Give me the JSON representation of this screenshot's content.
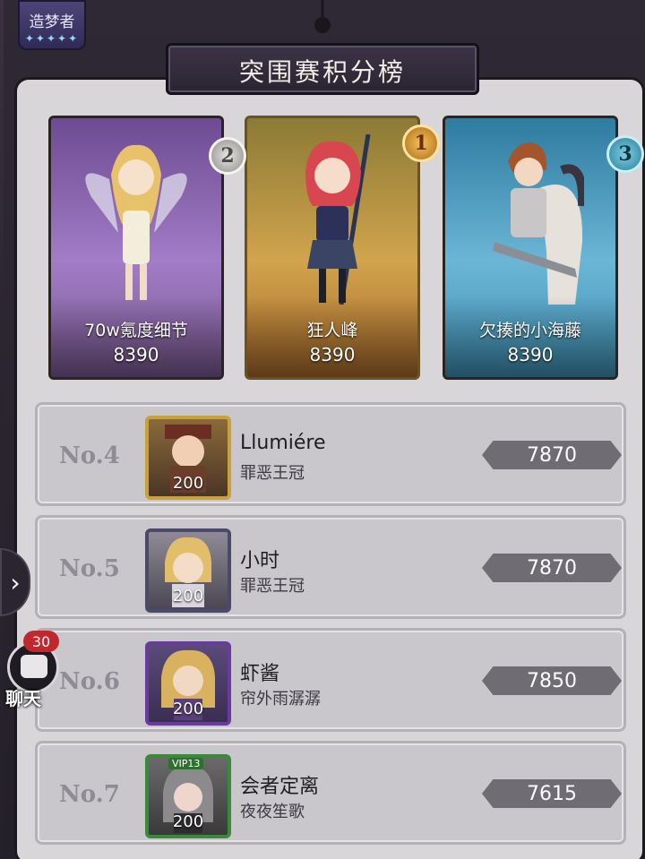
{
  "header": {
    "badge_label": "造梦者",
    "badge_stars": "✦✦✦✦✦",
    "title": "突围赛积分榜"
  },
  "podium": [
    {
      "place": "2",
      "name": "70w氪度细节",
      "score": "8390",
      "color": "#a27cc6"
    },
    {
      "place": "1",
      "name": "狂人峰",
      "score": "8390",
      "color": "#d1a44d"
    },
    {
      "place": "3",
      "name": "欠揍的小海藤",
      "score": "8390",
      "color": "#6bb6d6"
    }
  ],
  "rows": [
    {
      "rank": "No.4",
      "name": "Llumiére",
      "title": "罪恶王冠",
      "level": "200",
      "score": "7870"
    },
    {
      "rank": "No.5",
      "name": "小时",
      "title": "罪恶王冠",
      "level": "200",
      "score": "7870"
    },
    {
      "rank": "No.6",
      "name": "虾酱",
      "title": "帘外雨潺潺",
      "level": "200",
      "score": "7850"
    },
    {
      "rank": "No.7",
      "name": "会者定离",
      "title": "夜夜笙歌",
      "level": "200",
      "score": "7615",
      "vip": "VIP13"
    }
  ],
  "chat": {
    "badge": "30",
    "label": "聊天"
  },
  "icons": {
    "side_arrow": "chevron-right-icon",
    "chat": "chat-bubble-icon"
  }
}
